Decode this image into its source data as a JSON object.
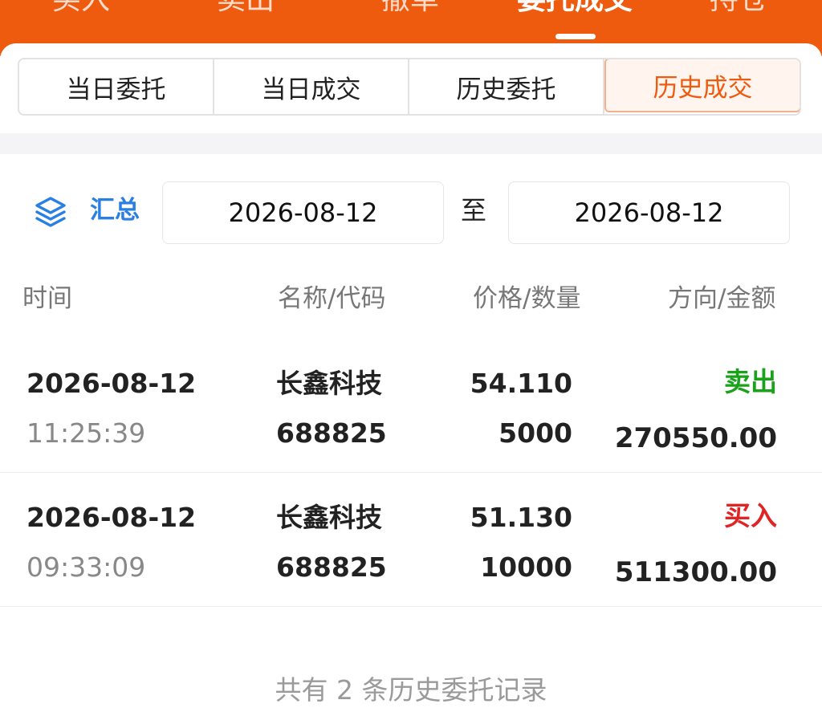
{
  "nav": {
    "tabs": [
      {
        "label": "买入"
      },
      {
        "label": "卖出"
      },
      {
        "label": "撤单"
      },
      {
        "label": "委托成交"
      },
      {
        "label": "持仓"
      }
    ],
    "active_index": 3
  },
  "subtabs": [
    {
      "label": "当日委托"
    },
    {
      "label": "当日成交"
    },
    {
      "label": "历史委托"
    },
    {
      "label": "历史成交"
    }
  ],
  "filter": {
    "summary_label": "汇总",
    "start_date": "2026-08-12",
    "to_label": "至",
    "end_date": "2026-08-12"
  },
  "table": {
    "headers": {
      "time": "时间",
      "name_code": "名称/代码",
      "price_qty": "价格/数量",
      "direction_amount": "方向/金额"
    },
    "rows": [
      {
        "date": "2026-08-12",
        "time": "11:25:39",
        "name": "长鑫科技",
        "code": "688825",
        "price": "54.110",
        "quantity": "5000",
        "direction": "卖出",
        "amount": "270550.00"
      },
      {
        "date": "2026-08-12",
        "time": "09:33:09",
        "name": "长鑫科技",
        "code": "688825",
        "price": "51.130",
        "quantity": "10000",
        "direction": "买入",
        "amount": "511300.00"
      }
    ]
  },
  "footer": {
    "text": "共有 2 条历史委托记录"
  },
  "colors": {
    "accent": "#ee5a0e",
    "link_blue": "#2a7fe4",
    "sell_green": "#1aa21a",
    "buy_red": "#e02323"
  },
  "icons": {
    "summary": "layers-icon"
  }
}
